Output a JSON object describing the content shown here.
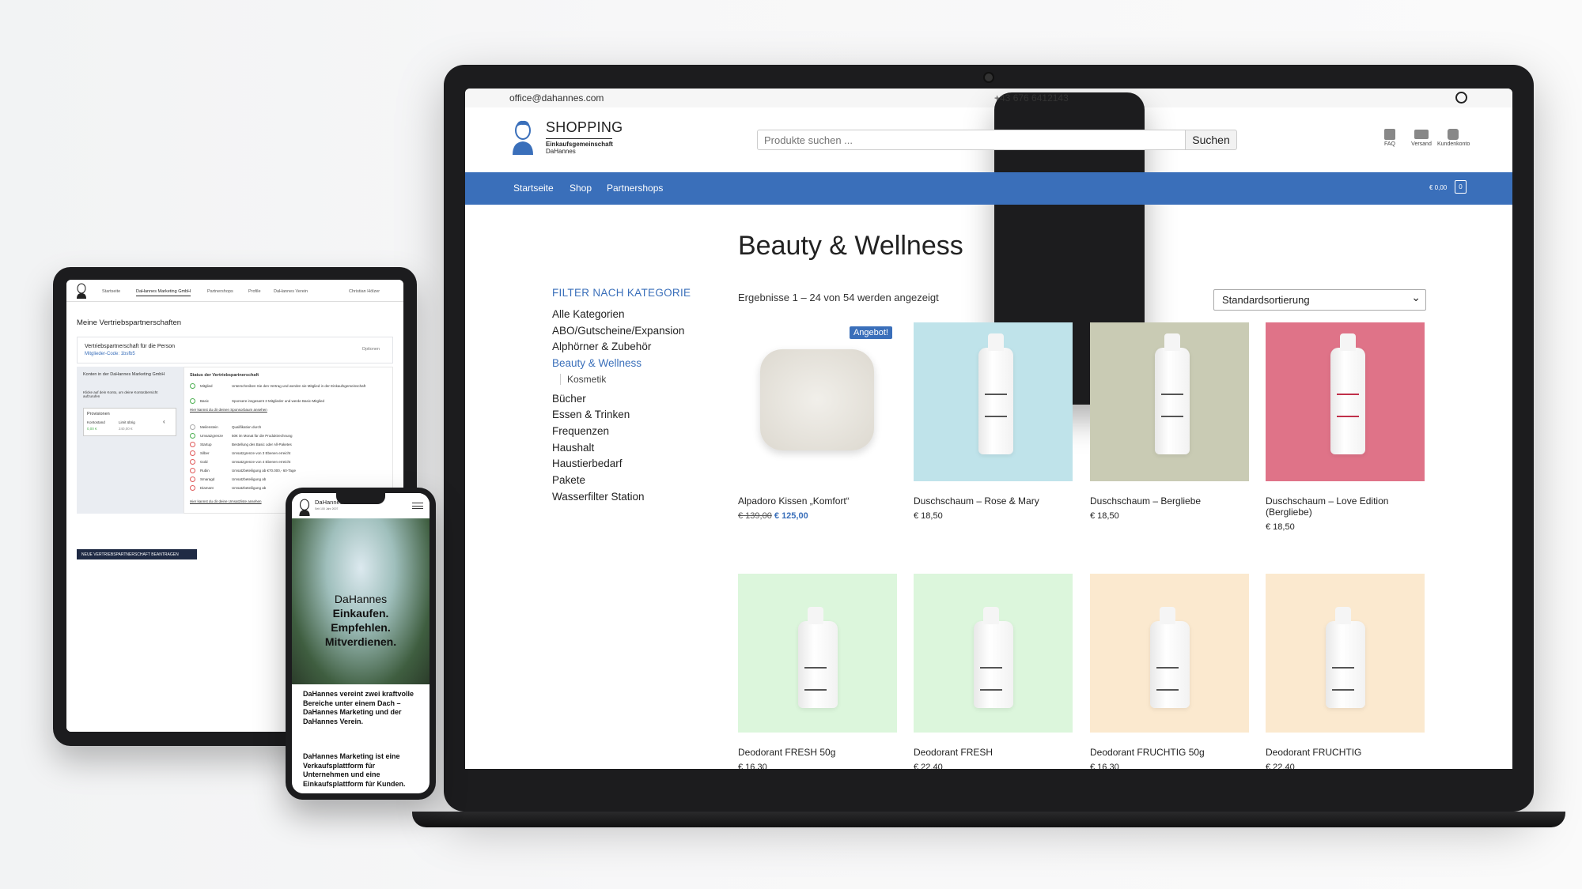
{
  "laptop": {
    "topbar": {
      "email": "office@dahannes.com",
      "phone": "+43 676 6412143",
      "whatsapp_icon": "whatsapp-icon"
    },
    "logo": {
      "title": "SHOPPING",
      "sub1": "Einkaufsgemeinschaft",
      "sub2": "DaHannes"
    },
    "search": {
      "placeholder": "Produkte suchen ...",
      "button": "Suchen"
    },
    "header_icons": [
      {
        "label": "FAQ",
        "icon": "question-icon"
      },
      {
        "label": "Versand",
        "icon": "truck-icon"
      },
      {
        "label": "Kundenkonto",
        "icon": "user-icon"
      }
    ],
    "nav": {
      "items": [
        "Startseite",
        "Shop",
        "Partnershops"
      ],
      "cart_total": "€ 0,00",
      "cart_count": "0"
    },
    "page_title": "Beauty & Wellness",
    "filter": {
      "title": "FILTER NACH KATEGORIE",
      "categories": [
        "Alle Kategorien",
        "ABO/Gutscheine/Expansion",
        "Alphörner & Zubehör",
        "Beauty & Wellness",
        "Kosmetik",
        "Bücher",
        "Essen & Trinken",
        "Frequenzen",
        "Haushalt",
        "Haustierbedarf",
        "Pakete",
        "Wasserfilter Station"
      ]
    },
    "results_text": "Ergebnisse 1 – 24 von 54 werden angezeigt",
    "sort": "Standardsortierung",
    "sale_badge": "Angebot!",
    "products": [
      {
        "name": "Alpadoro Kissen „Komfort“",
        "old_price": "€ 139,00",
        "price": "€ 125,00",
        "bg": "#ffffff"
      },
      {
        "name": "Duschschaum – Rose & Mary",
        "price": "€ 18,50",
        "bg": "#bfe3ea"
      },
      {
        "name": "Duschschaum – Bergliebe",
        "price": "€ 18,50",
        "bg": "#c9cbb4"
      },
      {
        "name": "Duschschaum – Love Edition (Bergliebe)",
        "price": "€ 18,50",
        "bg": "#df7388"
      },
      {
        "name": "Deodorant FRESH 50g",
        "price": "€ 16,30",
        "bg": "#dcf6dc"
      },
      {
        "name": "Deodorant FRESH",
        "price": "€ 22,40",
        "bg": "#dcf6dc"
      },
      {
        "name": "Deodorant FRUCHTIG 50g",
        "price": "€ 16,30",
        "bg": "#fbe9cf"
      },
      {
        "name": "Deodorant FRUCHTIG",
        "price": "€ 22,40",
        "bg": "#fbe9cf"
      }
    ]
  },
  "tablet": {
    "nav": [
      "Startseite",
      "DaHannes Marketing GmbH",
      "Partnershops",
      "Profile",
      "DaHannes Verein"
    ],
    "user": "Christian Hölzer",
    "heading": "Meine Vertriebspartnerschaften",
    "card_title": "Vertriebspartnerschaft für die Person",
    "card_code": "Mitglieder-Code: 1bsfb5",
    "card_options": "Optionen",
    "left_title": "Konten in der DaHannes Marketing GmbH",
    "left_desc": "Klicke auf dein Konto, um deine Kontoübersicht aufzurufen",
    "prov_title": "Provisionen",
    "prov_labels": [
      "Kontostand",
      "Limit übrig"
    ],
    "prov_values": [
      "0,00 €",
      "240,00 €"
    ],
    "status_title": "Status der Vertriebspartnerschaft",
    "status_rows": [
      {
        "label": "Mitglied",
        "text": "Unterschreiben Sie den Vertrag und werden sie Mitglied in der Einkaufsgemeinschaft"
      },
      {
        "label": "Basic",
        "text": "Sponsere insgesamt 3 Mitglieder und werde Basic-Mitglied"
      }
    ],
    "sponsor_text": "Hier kannst du dir deinen Sponsorbaum ansehen",
    "milestone_header": [
      "Meilenstein",
      "Qualifikation durch"
    ],
    "milestones": [
      {
        "label": "Umsatzgrenze",
        "text": "50€ im Monat für die Produktrechnung"
      },
      {
        "label": "Startup",
        "text": "Bestellung des Basic oder All-Paketes"
      },
      {
        "label": "Silber",
        "text": "Umsatzgrenze von 3 Ebenen erreicht"
      },
      {
        "label": "Gold",
        "text": "Umsatzgrenze von 4 Ebenen erreicht"
      },
      {
        "label": "Rubin",
        "text": "Umsatzbeteiligung ab €70.000,- 60-Tage"
      },
      {
        "label": "Smaragd",
        "text": "Umsatzbeteiligung ab"
      },
      {
        "label": "Diamant",
        "text": "Umsatzbeteiligung ab"
      }
    ],
    "umsatz_text": "Hier kannst du dir deine Umsatzliste ansehen",
    "button": "NEUE VERTRIEBSPARTNERSCHAFT BEANTRAGEN"
  },
  "phone": {
    "brand": "DaHannes",
    "brand_sub": "Seit 100 Jahr 2007",
    "hero": [
      "DaHannes",
      "Einkaufen.",
      "Empfehlen.",
      "Mitverdienen."
    ],
    "para1": "DaHannes vereint zwei kraftvolle Bereiche unter einem Dach – DaHannes Marketing und der DaHannes Verein.",
    "para2": "DaHannes Marketing ist eine Verkaufsplattform für Unternehmen und eine Einkaufsplattform für Kunden."
  },
  "colors": {
    "accent": "#3a6fba",
    "device": "#1c1c1e"
  }
}
